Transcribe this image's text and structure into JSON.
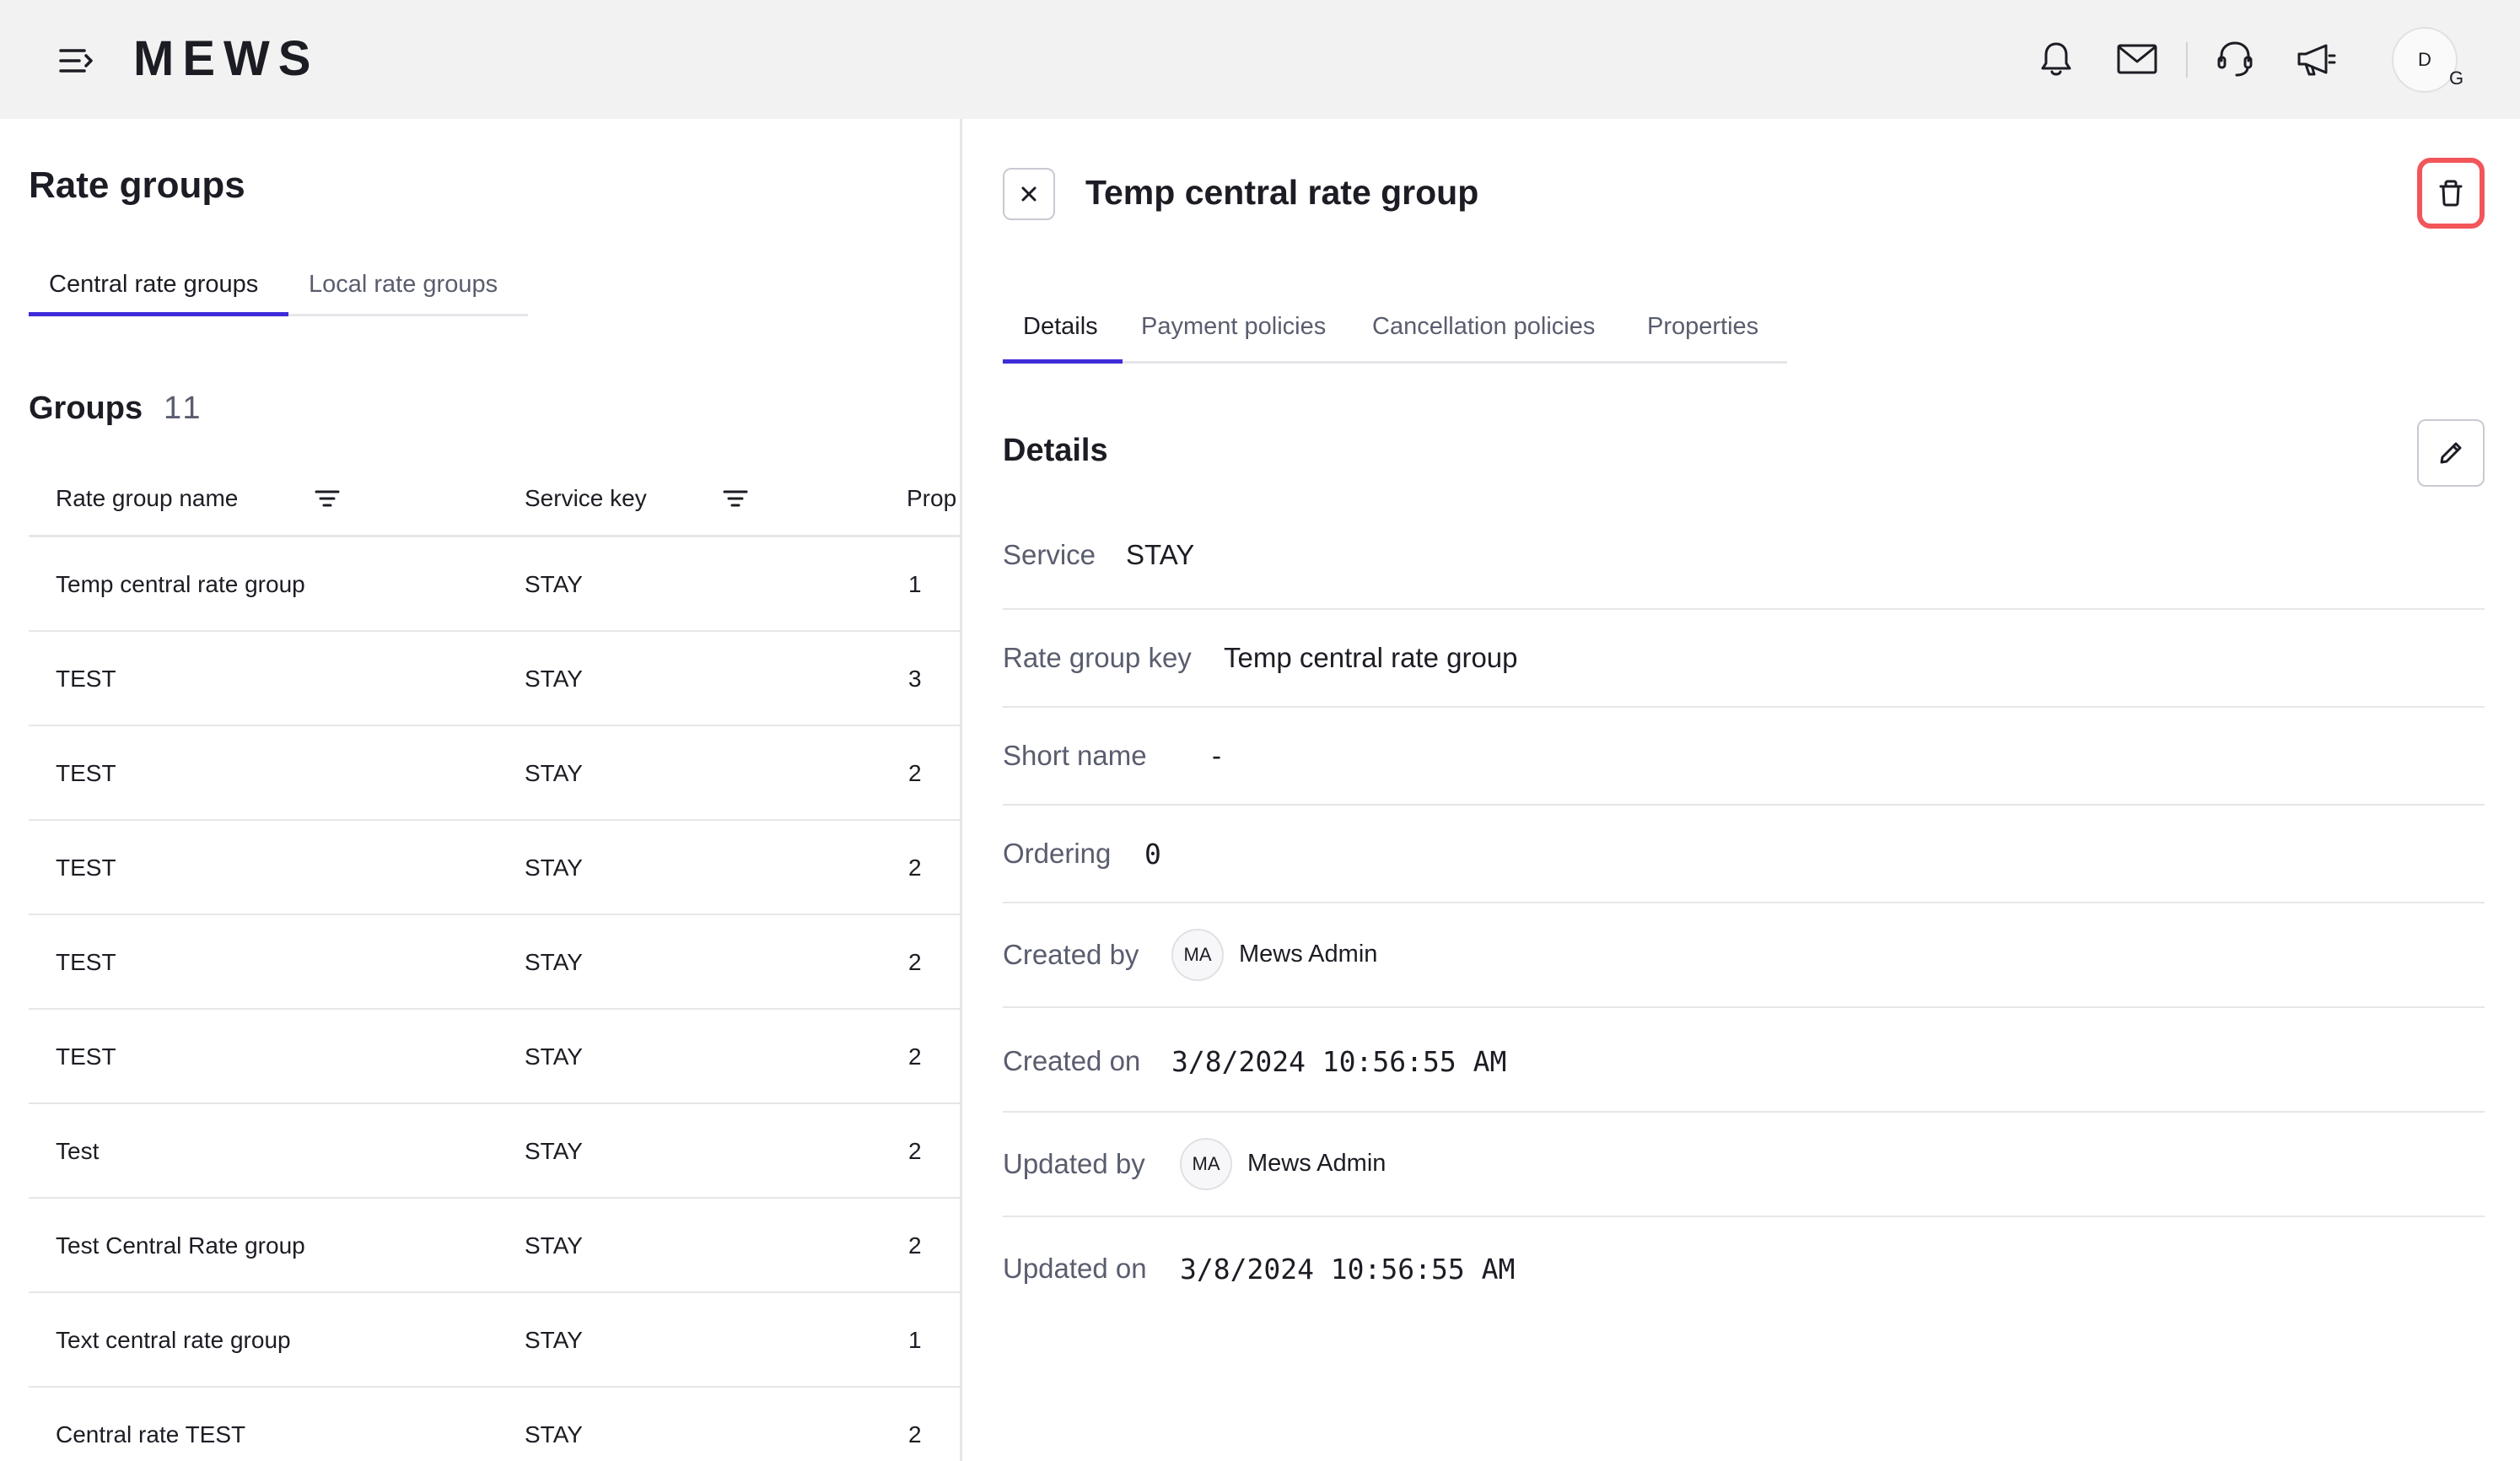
{
  "topbar": {
    "logo": "MEWS",
    "icons": [
      "menu-icon",
      "bell-icon",
      "mail-icon",
      "headset-icon",
      "megaphone-icon"
    ],
    "avatar_initial": "D",
    "avatar_sub": "G"
  },
  "left": {
    "title": "Rate groups",
    "tabs": [
      {
        "label": "Central rate groups",
        "active": true
      },
      {
        "label": "Local rate groups",
        "active": false
      }
    ],
    "groups_label": "Groups",
    "groups_count": "11",
    "columns": [
      "Rate group name",
      "Service key",
      "Prop"
    ],
    "rows": [
      {
        "name": "Temp central rate group",
        "service": "STAY",
        "prop": "1"
      },
      {
        "name": "TEST",
        "service": "STAY",
        "prop": "3"
      },
      {
        "name": "TEST",
        "service": "STAY",
        "prop": "2"
      },
      {
        "name": "TEST",
        "service": "STAY",
        "prop": "2"
      },
      {
        "name": "TEST",
        "service": "STAY",
        "prop": "2"
      },
      {
        "name": "TEST",
        "service": "STAY",
        "prop": "2"
      },
      {
        "name": "Test",
        "service": "STAY",
        "prop": "2"
      },
      {
        "name": "Test Central Rate group",
        "service": "STAY",
        "prop": "2"
      },
      {
        "name": "Text central rate group",
        "service": "STAY",
        "prop": "1"
      },
      {
        "name": "Central rate TEST",
        "service": "STAY",
        "prop": "2"
      }
    ]
  },
  "detail": {
    "title": "Temp central rate group",
    "tabs": [
      {
        "label": "Details",
        "active": true
      },
      {
        "label": "Payment policies",
        "active": false
      },
      {
        "label": "Cancellation policies",
        "active": false
      },
      {
        "label": "Properties",
        "active": false
      }
    ],
    "section_title": "Details",
    "fields": {
      "service": {
        "label": "Service",
        "value": "STAY"
      },
      "rate_group_key": {
        "label": "Rate group key",
        "value": "Temp central rate group"
      },
      "short_name": {
        "label": "Short name",
        "value": "-"
      },
      "ordering": {
        "label": "Ordering",
        "value": "0"
      },
      "created_by": {
        "label": "Created by",
        "initials": "MA",
        "value": "Mews Admin"
      },
      "created_on": {
        "label": "Created on",
        "value": "3/8/2024 10:56:55 AM"
      },
      "updated_by": {
        "label": "Updated by",
        "initials": "MA",
        "value": "Mews Admin"
      },
      "updated_on": {
        "label": "Updated on",
        "value": "3/8/2024 10:56:55 AM"
      }
    }
  },
  "colors": {
    "accent": "#3f2cd9",
    "highlight_border": "#f2555a",
    "topbar_bg": "#f2f2f2",
    "muted_text": "#5a5d6e",
    "divider": "#e6e6ea"
  }
}
